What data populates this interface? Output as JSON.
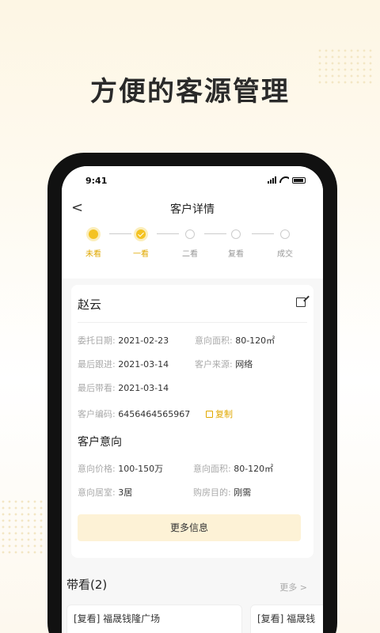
{
  "headline": "方便的客源管理",
  "status": {
    "time": "9:41"
  },
  "nav": {
    "back": "<",
    "title": "客户详情"
  },
  "steps": [
    {
      "label": "未看",
      "state": "active"
    },
    {
      "label": "一看",
      "state": "done"
    },
    {
      "label": "二看",
      "state": "todo"
    },
    {
      "label": "复看",
      "state": "todo"
    },
    {
      "label": "成交",
      "state": "todo"
    }
  ],
  "customer": {
    "name": "赵云",
    "fields": [
      {
        "key": "委托日期:",
        "value": "2021-02-23"
      },
      {
        "key": "意向面积:",
        "value": "80-120㎡"
      },
      {
        "key": "最后跟进:",
        "value": "2021-03-14"
      },
      {
        "key": "客户来源:",
        "value": "网络"
      },
      {
        "key": "最后带看:",
        "value": "2021-03-14"
      },
      {
        "key": "客户编码:",
        "value": "6456464565967"
      }
    ],
    "copy_label": "复制"
  },
  "intent": {
    "title": "客户意向",
    "fields": [
      {
        "key": "意向价格:",
        "value": "100-150万"
      },
      {
        "key": "意向面积:",
        "value": "80-120㎡"
      },
      {
        "key": "意向居室:",
        "value": "3居"
      },
      {
        "key": "购房目的:",
        "value": "刚需"
      }
    ],
    "more_info": "更多信息"
  },
  "viewings": {
    "title": "带看(2)",
    "more": "更多 >",
    "items": [
      "[复看] 福晟钱隆广场",
      "[复看] 福晟钱"
    ]
  },
  "colors": {
    "accent": "#f4c322",
    "accent_text": "#e0a800",
    "button_bg": "#fdf2d6"
  }
}
